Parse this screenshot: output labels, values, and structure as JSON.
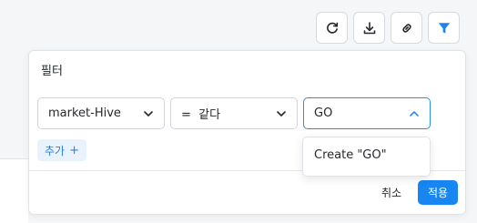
{
  "toolbar": {
    "buttons": [
      {
        "name": "refresh",
        "icon": "refresh-icon"
      },
      {
        "name": "download",
        "icon": "download-icon"
      },
      {
        "name": "link",
        "icon": "link-icon"
      },
      {
        "name": "filter",
        "icon": "filter-icon",
        "active": true
      }
    ]
  },
  "filter_panel": {
    "title": "필터",
    "field_select": {
      "value": "market-Hive"
    },
    "operator_select": {
      "value": "=  같다"
    },
    "value_select": {
      "value": "GO",
      "open": true
    },
    "add_button_label": "추가",
    "add_button_icon": "+",
    "cancel_label": "취소",
    "apply_label": "적용"
  },
  "value_dropdown": {
    "options": [
      {
        "label": "Create \"GO\""
      }
    ]
  },
  "colors": {
    "accent": "#1786f0",
    "accent_light": "#e9f3fd",
    "border": "#cfd5db",
    "text": "#26292d"
  }
}
